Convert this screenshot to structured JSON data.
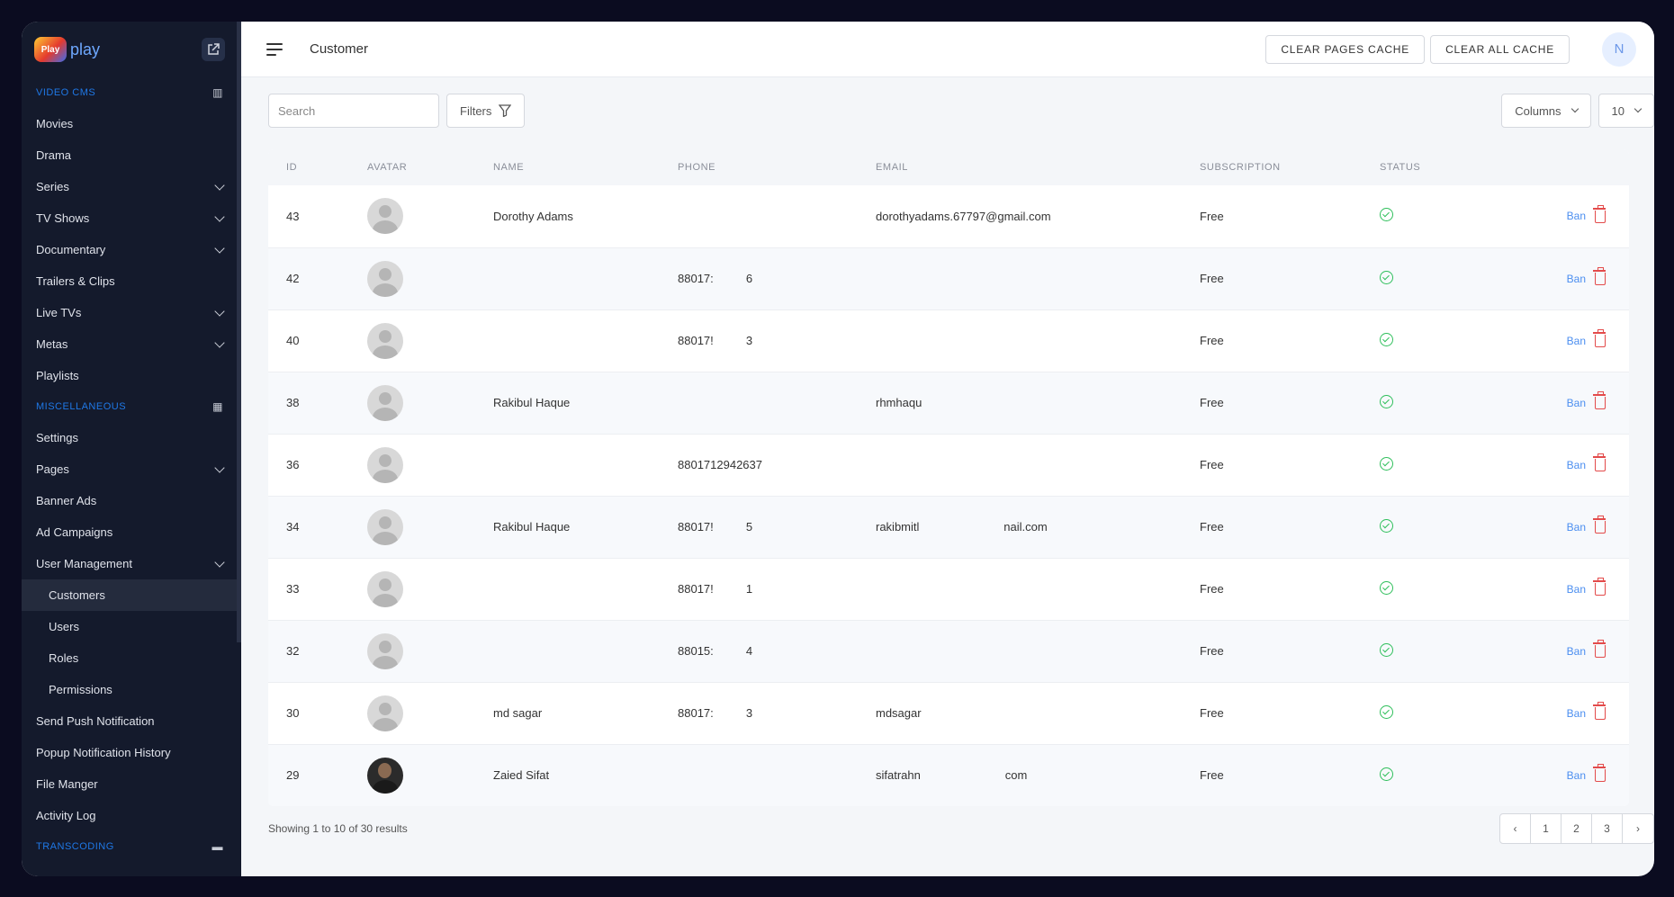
{
  "app": {
    "logo_badge": "Play",
    "logo_text": "play"
  },
  "sidebar": {
    "sections": [
      {
        "label": "VIDEO CMS",
        "icon": "film-icon"
      },
      {
        "label": "MISCELLANEOUS",
        "icon": "grid-icon"
      },
      {
        "label": "TRANSCODING",
        "icon": "server-icon"
      }
    ],
    "items": [
      {
        "label": "Movies"
      },
      {
        "label": "Drama"
      },
      {
        "label": "Series"
      },
      {
        "label": "TV Shows"
      },
      {
        "label": "Documentary"
      },
      {
        "label": "Trailers & Clips"
      },
      {
        "label": "Live TVs"
      },
      {
        "label": "Metas"
      },
      {
        "label": "Playlists"
      },
      {
        "label": "Settings"
      },
      {
        "label": "Pages"
      },
      {
        "label": "Banner Ads"
      },
      {
        "label": "Ad Campaigns"
      },
      {
        "label": "User Management"
      },
      {
        "label": "Customers"
      },
      {
        "label": "Users"
      },
      {
        "label": "Roles"
      },
      {
        "label": "Permissions"
      },
      {
        "label": "Send Push Notification"
      },
      {
        "label": "Popup Notification History"
      },
      {
        "label": "File Manger"
      },
      {
        "label": "Activity Log"
      }
    ]
  },
  "header": {
    "title": "Customer",
    "clear_pages_cache": "CLEAR PAGES CACHE",
    "clear_all_cache": "CLEAR ALL CACHE",
    "avatar_initial": "N"
  },
  "toolbar": {
    "search_placeholder": "Search",
    "filters_label": "Filters",
    "columns_label": "Columns",
    "page_size": "10"
  },
  "table": {
    "headers": [
      "ID",
      "AVATAR",
      "NAME",
      "PHONE",
      "EMAIL",
      "SUBSCRIPTION",
      "STATUS"
    ],
    "ban_label": "Ban",
    "rows": [
      {
        "id": "43",
        "name": "Dorothy Adams",
        "phone": "",
        "email": "dorothyadams.67797@gmail.com",
        "subscription": "Free",
        "photo": false
      },
      {
        "id": "42",
        "name": "",
        "phone": "88017:          6",
        "email": "",
        "subscription": "Free",
        "photo": false
      },
      {
        "id": "40",
        "name": "",
        "phone": "88017!          3",
        "email": "",
        "subscription": "Free",
        "photo": false
      },
      {
        "id": "38",
        "name": "Rakibul Haque",
        "phone": "",
        "email": "rhmhaqu",
        "subscription": "Free",
        "photo": false
      },
      {
        "id": "36",
        "name": "",
        "phone": "8801712942637",
        "email": "",
        "subscription": "Free",
        "photo": false
      },
      {
        "id": "34",
        "name": "Rakibul Haque",
        "phone": "88017!          5",
        "email": "rakibmitl                          nail.com",
        "subscription": "Free",
        "photo": false
      },
      {
        "id": "33",
        "name": "",
        "phone": "88017!          1",
        "email": "",
        "subscription": "Free",
        "photo": false
      },
      {
        "id": "32",
        "name": "",
        "phone": "88015:          4",
        "email": "",
        "subscription": "Free",
        "photo": false
      },
      {
        "id": "30",
        "name": "md sagar",
        "phone": "88017:          3",
        "email": "mdsagar",
        "subscription": "Free",
        "photo": false
      },
      {
        "id": "29",
        "name": "Zaied Sifat",
        "phone": "",
        "email": "sifatrahn                          com",
        "subscription": "Free",
        "photo": true
      }
    ]
  },
  "footer": {
    "results_text": "Showing 1 to 10 of 30 results",
    "pages": [
      "1",
      "2",
      "3"
    ],
    "prev": "‹",
    "next": "›"
  },
  "colors": {
    "sidebar_bg": "#141a2c",
    "accent": "#1f78e6",
    "status_ok": "#2fbf5b",
    "danger": "#e34b4b"
  }
}
